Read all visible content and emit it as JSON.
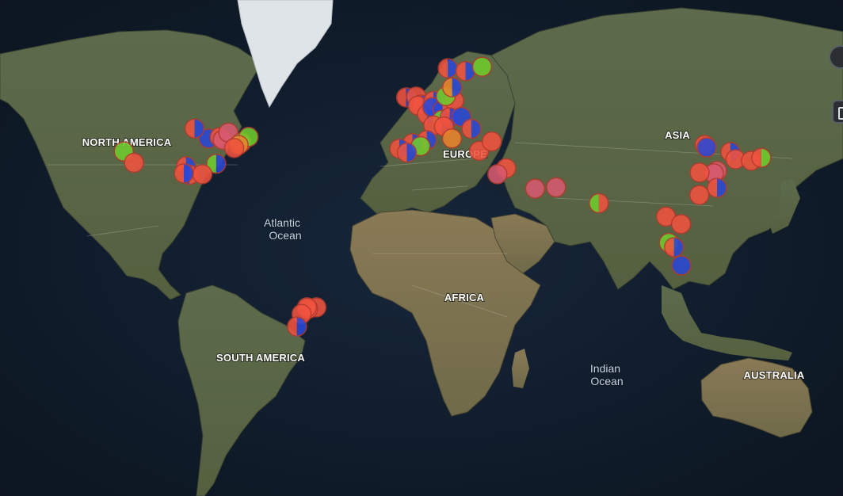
{
  "map": {
    "style": "satellite",
    "continents": {
      "north_america": "NORTH AMERICA",
      "south_america": "SOUTH AMERICA",
      "europe": "EUROPE",
      "africa": "AFRICA",
      "asia": "ASIA",
      "australia": "AUSTRALIA"
    },
    "oceans": {
      "atlantic": [
        "Atlantic",
        "Ocean"
      ],
      "indian": [
        "Indian",
        "Ocean"
      ]
    }
  },
  "colors": {
    "red": "#f0533f",
    "blue": "#2a48d6",
    "green": "#6fcc2d",
    "orange": "#e8842c",
    "pink": "#d75a6f",
    "marker_stroke": "#b23a2e"
  },
  "markers": [
    {
      "id": "seattle",
      "lat": 47.6,
      "lon": -122.3,
      "segments": []
    },
    {
      "id": "sf-green",
      "lat": 37.8,
      "lon": -122.4,
      "segments": [
        "green"
      ]
    },
    {
      "id": "la",
      "lat": 34.0,
      "lon": -118.2,
      "segments": [
        "red"
      ]
    },
    {
      "id": "chicago",
      "lat": 41.9,
      "lon": -87.6,
      "segments": [
        "blue"
      ]
    },
    {
      "id": "minneapolis",
      "lat": 44.9,
      "lon": -93.3,
      "segments": [
        "red",
        "blue"
      ]
    },
    {
      "id": "detroit",
      "lat": 42.3,
      "lon": -83.0,
      "segments": [
        "red"
      ]
    },
    {
      "id": "cleveland",
      "lat": 41.5,
      "lon": -81.7,
      "segments": [
        "pink"
      ]
    },
    {
      "id": "toronto",
      "lat": 43.7,
      "lon": -79.4,
      "segments": [
        "pink"
      ]
    },
    {
      "id": "nyc",
      "lat": 40.7,
      "lon": -74.0,
      "segments": [
        "green",
        "orange"
      ]
    },
    {
      "id": "boston",
      "lat": 42.4,
      "lon": -71.1,
      "segments": [
        "green"
      ]
    },
    {
      "id": "philadelphia",
      "lat": 39.9,
      "lon": -75.2,
      "segments": [
        "orange"
      ]
    },
    {
      "id": "dc",
      "lat": 38.9,
      "lon": -77.0,
      "segments": [
        "red"
      ]
    },
    {
      "id": "atlanta",
      "lat": 33.7,
      "lon": -84.4,
      "segments": [
        "green",
        "blue"
      ]
    },
    {
      "id": "dallas",
      "lat": 32.8,
      "lon": -96.8,
      "segments": [
        "red",
        "blue"
      ]
    },
    {
      "id": "houston",
      "lat": 29.8,
      "lon": -95.4,
      "segments": [
        "blue",
        "red"
      ]
    },
    {
      "id": "new-orleans",
      "lat": 30.0,
      "lon": -90.1,
      "segments": [
        "red"
      ]
    },
    {
      "id": "austin",
      "lat": 30.3,
      "lon": -97.7,
      "segments": [
        "red",
        "blue"
      ]
    },
    {
      "id": "rio",
      "lat": -22.9,
      "lon": -43.2,
      "segments": [
        "red"
      ]
    },
    {
      "id": "sao-paulo",
      "lat": -23.5,
      "lon": -46.6,
      "segments": [
        "red"
      ]
    },
    {
      "id": "campinas",
      "lat": -22.9,
      "lon": -47.1,
      "segments": [
        "red"
      ]
    },
    {
      "id": "curitiba",
      "lat": -25.4,
      "lon": -49.3,
      "segments": [
        "red"
      ]
    },
    {
      "id": "porto-alegre",
      "lat": -30.0,
      "lon": -51.2,
      "segments": [
        "red",
        "blue"
      ]
    },
    {
      "id": "dublin",
      "lat": 53.3,
      "lon": -6.3,
      "segments": [
        "red",
        "blue"
      ]
    },
    {
      "id": "manchester",
      "lat": 53.5,
      "lon": -2.2,
      "segments": [
        "red"
      ]
    },
    {
      "id": "london",
      "lat": 51.5,
      "lon": -0.1,
      "segments": [
        "red",
        "blue"
      ]
    },
    {
      "id": "oxford",
      "lat": 51.2,
      "lon": -1.5,
      "segments": [
        "red"
      ]
    },
    {
      "id": "paris",
      "lat": 48.9,
      "lon": 2.3,
      "segments": [
        "red",
        "blue"
      ]
    },
    {
      "id": "amsterdam",
      "lat": 52.4,
      "lon": 4.9,
      "segments": [
        "red",
        "blue"
      ]
    },
    {
      "id": "brussels",
      "lat": 50.8,
      "lon": 4.4,
      "segments": [
        "blue"
      ]
    },
    {
      "id": "frankfurt",
      "lat": 50.1,
      "lon": 8.7,
      "segments": [
        "blue",
        "red"
      ]
    },
    {
      "id": "berlin",
      "lat": 52.5,
      "lon": 13.4,
      "segments": [
        "red"
      ]
    },
    {
      "id": "hamburg",
      "lat": 53.6,
      "lon": 10.0,
      "segments": [
        "green"
      ]
    },
    {
      "id": "zurich",
      "lat": 47.4,
      "lon": 8.5,
      "segments": [
        "green",
        "blue"
      ]
    },
    {
      "id": "munich",
      "lat": 48.1,
      "lon": 11.6,
      "segments": [
        "red",
        "blue"
      ]
    },
    {
      "id": "vienna",
      "lat": 48.2,
      "lon": 16.4,
      "segments": [
        "blue"
      ]
    },
    {
      "id": "copenhagen",
      "lat": 55.7,
      "lon": 12.6,
      "segments": [
        "orange",
        "blue"
      ]
    },
    {
      "id": "oslo",
      "lat": 59.9,
      "lon": 10.8,
      "segments": [
        "red",
        "blue"
      ]
    },
    {
      "id": "stockholm",
      "lat": 59.3,
      "lon": 18.1,
      "segments": [
        "red",
        "blue"
      ]
    },
    {
      "id": "helsinki",
      "lat": 60.2,
      "lon": 24.9,
      "segments": [
        "green"
      ]
    },
    {
      "id": "lyon",
      "lat": 45.8,
      "lon": 4.8,
      "segments": [
        "red"
      ]
    },
    {
      "id": "milan",
      "lat": 45.5,
      "lon": 9.2,
      "segments": [
        "red"
      ]
    },
    {
      "id": "barcelona",
      "lat": 41.4,
      "lon": 2.2,
      "segments": [
        "red",
        "blue"
      ]
    },
    {
      "id": "madrid",
      "lat": 40.4,
      "lon": -3.7,
      "segments": [
        "red",
        "blue"
      ]
    },
    {
      "id": "valencia",
      "lat": 39.5,
      "lon": -0.4,
      "segments": [
        "green"
      ]
    },
    {
      "id": "lisbon",
      "lat": 38.7,
      "lon": -9.1,
      "segments": [
        "red",
        "blue"
      ]
    },
    {
      "id": "seville",
      "lat": 37.4,
      "lon": -6.0,
      "segments": [
        "red",
        "blue"
      ]
    },
    {
      "id": "rome",
      "lat": 41.9,
      "lon": 12.5,
      "segments": [
        "orange"
      ]
    },
    {
      "id": "belgrade",
      "lat": 44.8,
      "lon": 20.5,
      "segments": [
        "red",
        "blue"
      ]
    },
    {
      "id": "athens",
      "lat": 38.0,
      "lon": 23.7,
      "segments": [
        "red"
      ]
    },
    {
      "id": "istanbul",
      "lat": 41.0,
      "lon": 28.9,
      "segments": [
        "red"
      ]
    },
    {
      "id": "tel-aviv",
      "lat": 32.1,
      "lon": 34.8,
      "segments": [
        "red"
      ]
    },
    {
      "id": "riyadh",
      "lat": 24.7,
      "lon": 46.7,
      "segments": [
        "pink"
      ]
    },
    {
      "id": "cairo",
      "lat": 30.0,
      "lon": 31.2,
      "segments": [
        "pink"
      ]
    },
    {
      "id": "dubai",
      "lat": 25.2,
      "lon": 55.3,
      "segments": [
        "pink"
      ]
    },
    {
      "id": "mumbai",
      "lat": 19.1,
      "lon": 72.9,
      "segments": [
        "green",
        "red"
      ]
    },
    {
      "id": "bangkok",
      "lat": 13.8,
      "lon": 100.5,
      "segments": [
        "red"
      ]
    },
    {
      "id": "ho-chi-minh",
      "lat": 10.8,
      "lon": 106.7,
      "segments": [
        "red"
      ]
    },
    {
      "id": "kuala-lumpur",
      "lat": 3.1,
      "lon": 101.7,
      "segments": [
        "green"
      ]
    },
    {
      "id": "singapore",
      "lat": 1.3,
      "lon": 103.8,
      "segments": [
        "red",
        "blue"
      ]
    },
    {
      "id": "jakarta",
      "lat": -6.2,
      "lon": 106.8,
      "segments": [
        "blue"
      ]
    },
    {
      "id": "beijing",
      "lat": 39.9,
      "lon": 116.4,
      "segments": [
        "red"
      ]
    },
    {
      "id": "tianjin",
      "lat": 39.1,
      "lon": 117.2,
      "segments": [
        "blue"
      ]
    },
    {
      "id": "shanghai",
      "lat": 31.2,
      "lon": 121.5,
      "segments": [
        "pink"
      ]
    },
    {
      "id": "hangzhou",
      "lat": 30.3,
      "lon": 120.2,
      "segments": [
        "pink"
      ]
    },
    {
      "id": "wuhan",
      "lat": 30.6,
      "lon": 114.3,
      "segments": [
        "red"
      ]
    },
    {
      "id": "taipei",
      "lat": 25.0,
      "lon": 121.5,
      "segments": [
        "red",
        "blue"
      ]
    },
    {
      "id": "hong-kong",
      "lat": 22.3,
      "lon": 114.2,
      "segments": [
        "red"
      ]
    },
    {
      "id": "seoul",
      "lat": 37.6,
      "lon": 127.0,
      "segments": [
        "red",
        "blue"
      ]
    },
    {
      "id": "busan",
      "lat": 35.2,
      "lon": 129.1,
      "segments": [
        "red"
      ]
    },
    {
      "id": "osaka",
      "lat": 34.7,
      "lon": 135.5,
      "segments": [
        "red"
      ]
    },
    {
      "id": "tokyo",
      "lat": 35.7,
      "lon": 139.7,
      "segments": [
        "red",
        "green"
      ]
    }
  ]
}
